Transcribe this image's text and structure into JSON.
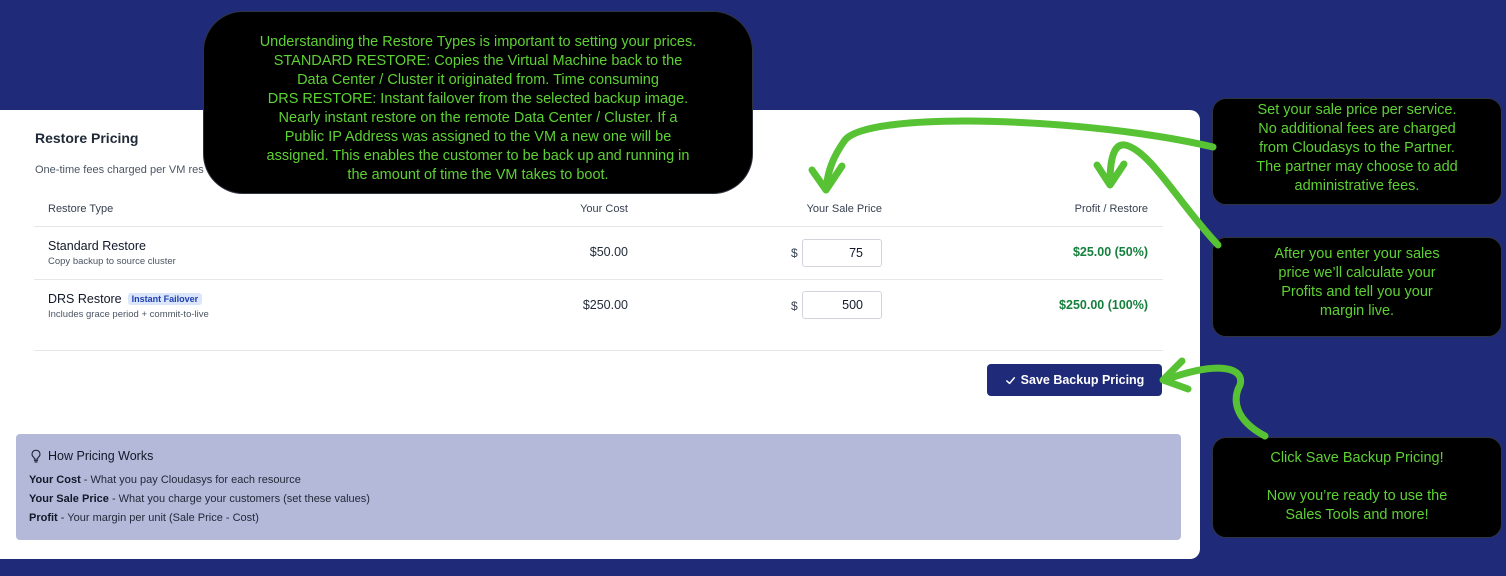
{
  "card": {
    "title": "Restore Pricing",
    "subtitle": "One-time fees charged per VM res"
  },
  "table": {
    "headers": [
      "Restore Type",
      "Your Cost",
      "Your Sale Price",
      "Profit / Restore"
    ],
    "rows": [
      {
        "name": "Standard Restore",
        "badge": "",
        "description": "Copy backup to source cluster",
        "cost": "$50.00",
        "currency": "$",
        "price": "75",
        "profit": "$25.00 (50%)"
      },
      {
        "name": "DRS Restore",
        "badge": "Instant Failover",
        "description": "Includes grace period + commit-to-live",
        "cost": "$250.00",
        "currency": "$",
        "price": "500",
        "profit": "$250.00 (100%)"
      }
    ]
  },
  "save_button": {
    "icon": "check-icon",
    "label": "Save Backup Pricing"
  },
  "info": {
    "icon": "lightbulb-icon",
    "title": "How Pricing Works",
    "items": [
      {
        "term": "Your Cost",
        "text": " - What you pay Cloudasys for each resource"
      },
      {
        "term": "Your Sale Price",
        "text": " - What you charge your customers (set these values)"
      },
      {
        "term": "Profit",
        "text": " - Your margin per unit (Sale Price - Cost)"
      }
    ]
  },
  "callouts": {
    "restore_types": [
      "Understanding the Restore Types is important to setting your prices.",
      "STANDARD RESTORE: Copies the Virtual Machine back to the",
      "Data Center / Cluster it originated from. Time consuming",
      "DRS RESTORE: Instant failover from the selected backup image.",
      "Nearly instant restore on the remote Data Center / Cluster. If a",
      "Public IP Address was assigned to the VM a new one will be",
      "assigned. This enables the customer to be back up and running in",
      "the amount of time the VM takes to boot."
    ],
    "sale_price": [
      "Set your sale price per service.",
      "No additional fees are charged",
      "from Cloudasys to the Partner.",
      "The partner may choose to add",
      "administrative fees."
    ],
    "profits": [
      "After you enter your sales",
      "price we’ll calculate your",
      "Profits and tell you your",
      "margin live."
    ],
    "save": [
      "Click Save Backup Pricing!",
      "",
      "Now you’re ready to use the",
      "Sales Tools and more!"
    ]
  },
  "colors": {
    "background": "#1f2a78",
    "callout_text": "#5ed134",
    "profit": "#15803d",
    "button": "#1f2a78",
    "info_box": "#b4b8d9"
  }
}
